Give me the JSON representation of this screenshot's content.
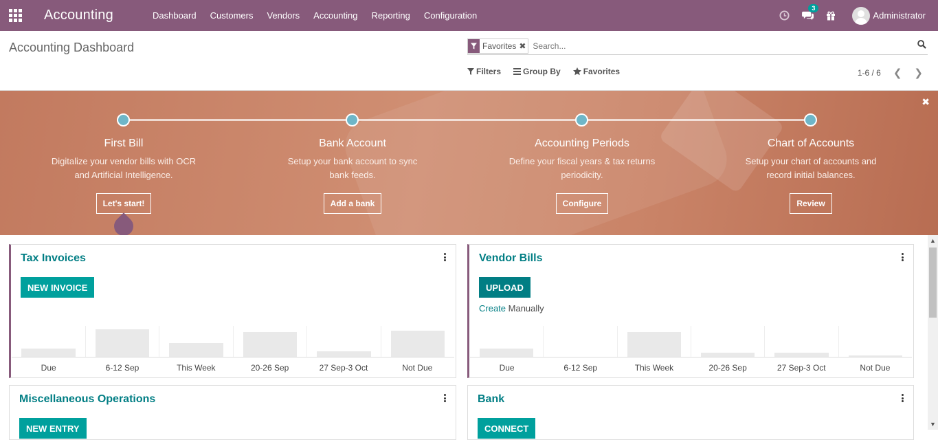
{
  "navbar": {
    "brand": "Accounting",
    "menu": [
      "Dashboard",
      "Customers",
      "Vendors",
      "Accounting",
      "Reporting",
      "Configuration"
    ],
    "message_count": "3",
    "user": "Administrator"
  },
  "control_panel": {
    "title": "Accounting Dashboard",
    "facet": "Favorites",
    "search_placeholder": "Search...",
    "filters_label": "Filters",
    "groupby_label": "Group By",
    "favorites_label": "Favorites",
    "pager": "1-6 / 6"
  },
  "onboarding": {
    "steps": [
      {
        "title": "First Bill",
        "desc1": "Digitalize your vendor bills with OCR",
        "desc2": "and Artificial Intelligence.",
        "button": "Let's start!"
      },
      {
        "title": "Bank Account",
        "desc1": "Setup your bank account to sync",
        "desc2": "bank feeds.",
        "button": "Add a bank"
      },
      {
        "title": "Accounting Periods",
        "desc1": "Define your fiscal years & tax returns",
        "desc2": "periodicity.",
        "button": "Configure"
      },
      {
        "title": "Chart of Accounts",
        "desc1": "Setup your chart of accounts and",
        "desc2": "record initial balances.",
        "button": "Review"
      }
    ]
  },
  "journals": {
    "sales": {
      "title": "Tax Invoices",
      "button": "NEW INVOICE",
      "labels": [
        "Due",
        "6-12 Sep",
        "This Week",
        "20-26 Sep",
        "27 Sep-3 Oct",
        "Not Due"
      ],
      "values": [
        0.27,
        0.9,
        0.45,
        0.8,
        0.18,
        0.85
      ]
    },
    "purchase": {
      "title": "Vendor Bills",
      "button": "UPLOAD",
      "create_link": "Create",
      "create_text": " Manually",
      "labels": [
        "Due",
        "6-12 Sep",
        "This Week",
        "20-26 Sep",
        "27 Sep-3 Oct",
        "Not Due"
      ],
      "values": [
        0.27,
        0,
        0.8,
        0.13,
        0.13,
        0.04
      ]
    },
    "misc": {
      "title": "Miscellaneous Operations",
      "button": "NEW ENTRY"
    },
    "bank": {
      "title": "Bank",
      "button": "CONNECT"
    }
  }
}
